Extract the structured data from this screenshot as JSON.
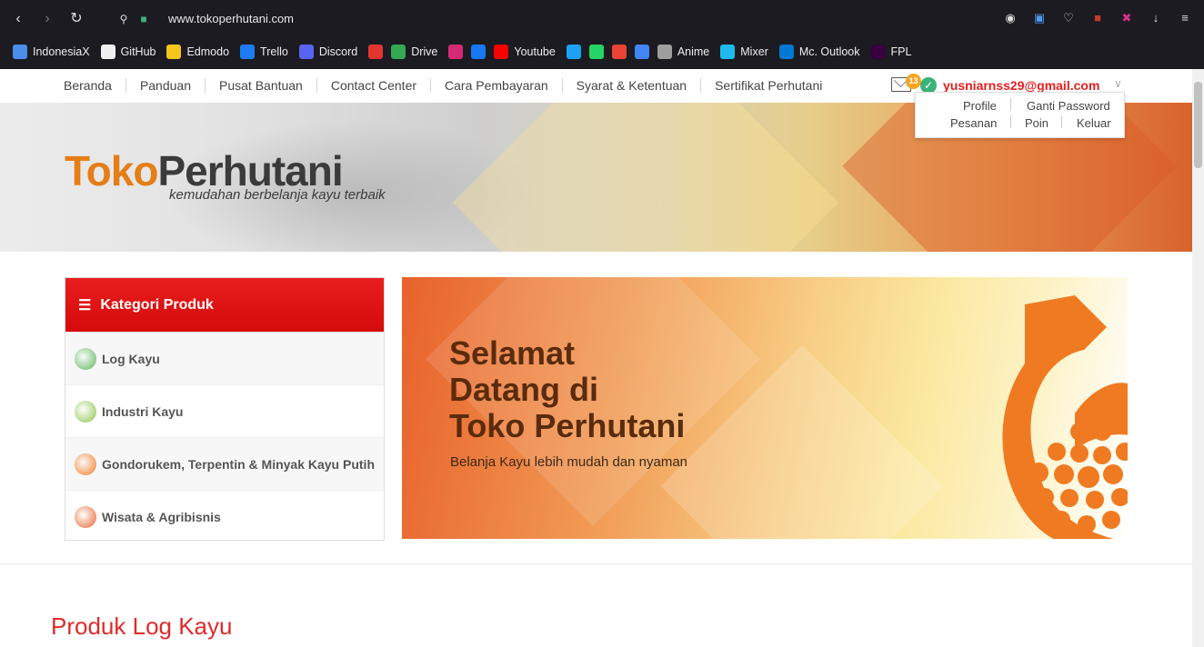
{
  "browser": {
    "url": "www.tokoperhutani.com",
    "bookmarks": [
      {
        "label": "IndonesiaX",
        "color": "#4a8ee8"
      },
      {
        "label": "GitHub",
        "color": "#f0f0f0"
      },
      {
        "label": "Edmodo",
        "color": "#f4c51d"
      },
      {
        "label": "Trello",
        "color": "#1d7cf2"
      },
      {
        "label": "Discord",
        "color": "#5865f2"
      },
      {
        "label": "",
        "color": "#e3342f"
      },
      {
        "label": "Drive",
        "color": "#34a853"
      },
      {
        "label": "",
        "color": "#d62976"
      },
      {
        "label": "",
        "color": "#1877f2"
      },
      {
        "label": "Youtube",
        "color": "#ff0000"
      },
      {
        "label": "",
        "color": "#1da1f2"
      },
      {
        "label": "",
        "color": "#25d366"
      },
      {
        "label": "",
        "color": "#ea4335"
      },
      {
        "label": "",
        "color": "#4285f4"
      },
      {
        "label": "Anime",
        "color": "#9e9e9e"
      },
      {
        "label": "Mixer",
        "color": "#1fbaed"
      },
      {
        "label": "Mc. Outlook",
        "color": "#0078d4"
      },
      {
        "label": "FPL",
        "color": "#38003c"
      }
    ]
  },
  "nav": {
    "items": [
      "Beranda",
      "Panduan",
      "Pusat Bantuan",
      "Contact Center",
      "Cara Pembayaran",
      "Syarat & Ketentuan",
      "Sertifikat Perhutani"
    ],
    "mail_count": "13",
    "user_email": "yusniarnss29@gmail.com"
  },
  "account_menu": {
    "profile": "Profile",
    "ganti_password": "Ganti Password",
    "pesanan": "Pesanan",
    "poin": "Poin",
    "keluar": "Keluar"
  },
  "banner": {
    "logo_part1": "Toko",
    "logo_part2": "Perhutani",
    "tagline": "kemudahan berbelanja kayu terbaik"
  },
  "categories": {
    "title": "Kategori Produk",
    "items": [
      {
        "label": "Log Kayu",
        "color": "#5cb85c"
      },
      {
        "label": "Industri Kayu",
        "color": "#8bc34a"
      },
      {
        "label": "Gondorukem, Terpentin & Minyak Kayu Putih",
        "color": "#f47c20"
      },
      {
        "label": "Wisata & Agribisnis",
        "color": "#e8632b"
      }
    ]
  },
  "hero": {
    "title": "Selamat\nDatang di\nToko Perhutani",
    "subtitle": "Belanja Kayu lebih mudah dan nyaman"
  },
  "section": {
    "title": "Produk Log Kayu"
  }
}
